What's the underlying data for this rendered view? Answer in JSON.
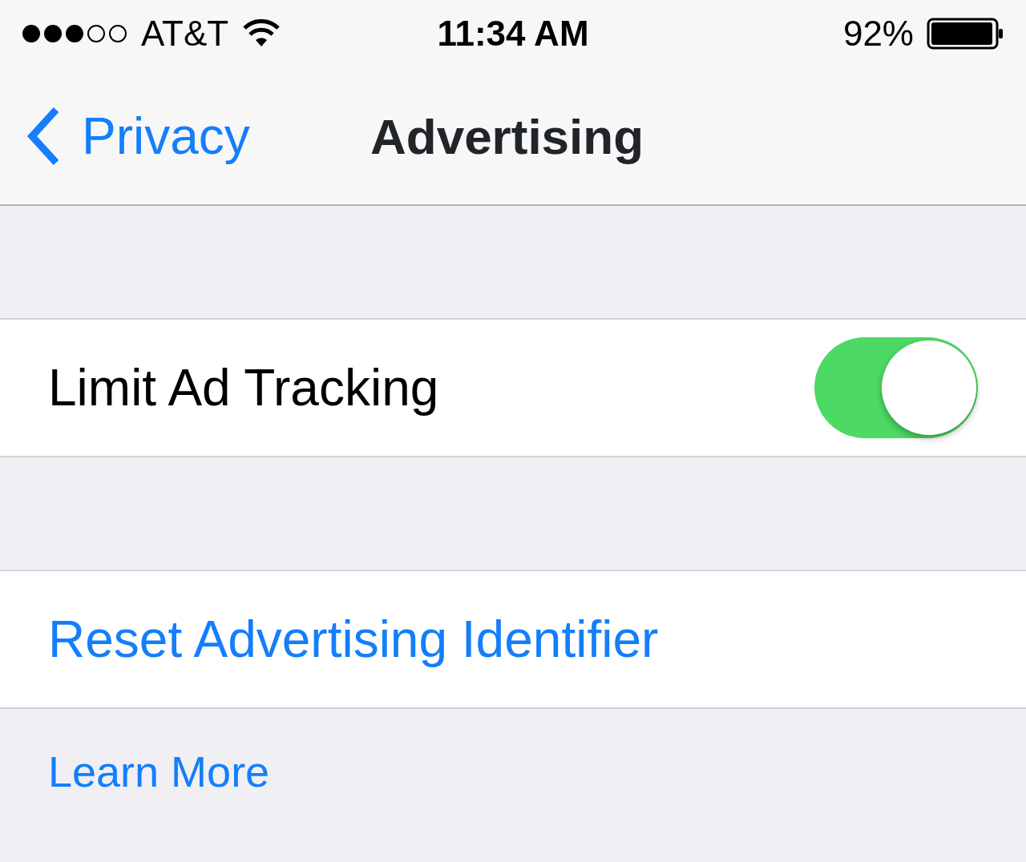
{
  "status_bar": {
    "carrier": "AT&T",
    "time": "11:34 AM",
    "battery": "92%"
  },
  "nav": {
    "back": "Privacy",
    "title": "Advertising"
  },
  "groups": [
    {
      "kind": "toggle",
      "label": "Limit Ad Tracking",
      "on": true
    },
    {
      "kind": "action",
      "label": "Reset Advertising Identifier"
    }
  ],
  "footer_link": "Learn More"
}
